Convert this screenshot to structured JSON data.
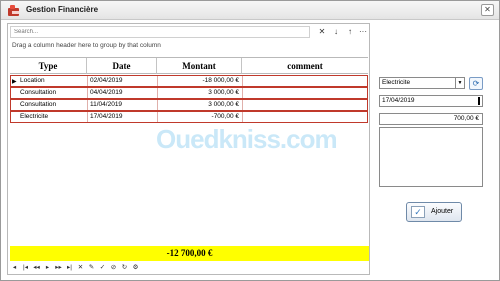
{
  "window": {
    "title": "Gestion Financière",
    "close": "✕"
  },
  "toolbar": {
    "search_placeholder": "Search...",
    "icons": {
      "clear": "✕",
      "down": "↓",
      "up": "↑",
      "more": "···"
    },
    "group_hint": "Drag a column header here to group by that column"
  },
  "table": {
    "columns": [
      "Type",
      "Date",
      "Montant",
      "comment"
    ],
    "rows": [
      {
        "type": "Location",
        "date": "02/04/2019",
        "amount": "-18 000,00 €",
        "comment": ""
      },
      {
        "type": "Consultation",
        "date": "04/04/2019",
        "amount": "3 000,00 €",
        "comment": ""
      },
      {
        "type": "Consultation",
        "date": "11/04/2019",
        "amount": "3 000,00 €",
        "comment": ""
      },
      {
        "type": "Electricite",
        "date": "17/04/2019",
        "amount": "-700,00 €",
        "comment": ""
      }
    ],
    "total": "-12 700,00 €"
  },
  "navigator": {
    "icons": [
      "◂",
      "|◂",
      "◂◂",
      "▸",
      "▸▸",
      "▸|",
      "✕",
      "✎",
      "✓",
      "⊘",
      "↻",
      "⚙"
    ]
  },
  "form": {
    "type_value": "Electricite",
    "date_value": "17/04/2019",
    "amount_value": "700,00 €",
    "comment_value": "",
    "add_label": "Ajouter"
  },
  "watermark": "Ouedkniss.com",
  "colors": {
    "total_bg": "#ffff00",
    "row_border": "#c0392b"
  }
}
